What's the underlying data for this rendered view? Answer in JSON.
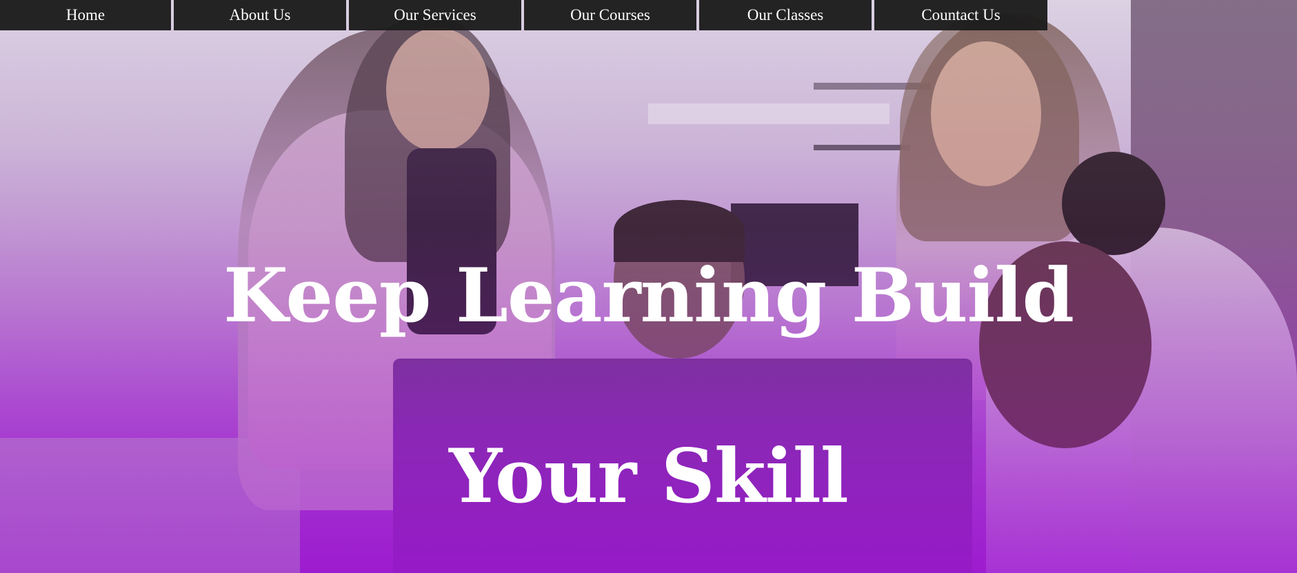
{
  "nav": {
    "items": [
      {
        "label": "Home"
      },
      {
        "label": "About Us"
      },
      {
        "label": "Our Services"
      },
      {
        "label": "Our Courses"
      },
      {
        "label": "Our Classes"
      },
      {
        "label": "Countact Us"
      }
    ]
  },
  "hero": {
    "headline_line1": "Keep Learning Build",
    "headline_line2": "Your Skill"
  },
  "colors": {
    "nav_background": "#1c1c1c",
    "nav_text": "#ffffff",
    "headline_text": "#ffffff",
    "overlay_accent": "#9a22cc"
  }
}
